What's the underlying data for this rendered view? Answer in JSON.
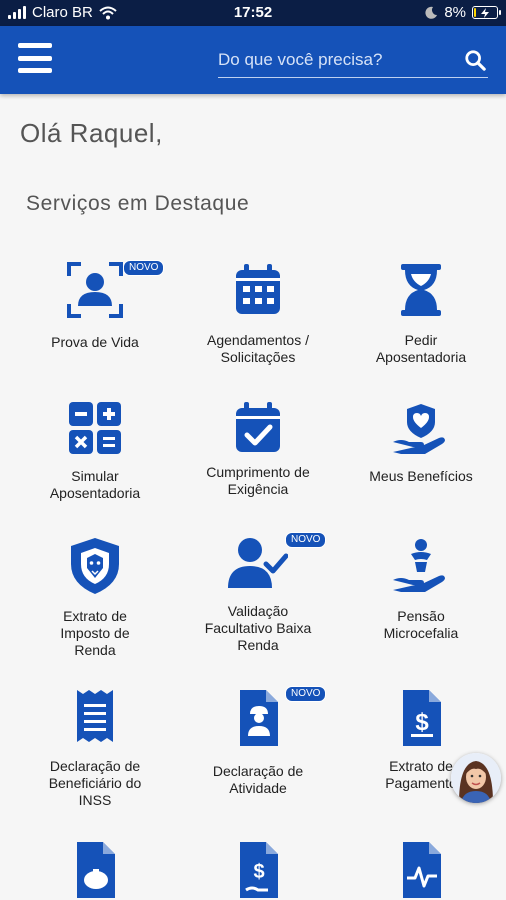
{
  "status_bar": {
    "carrier": "Claro BR",
    "time": "17:52",
    "battery": "8%",
    "battery_level": 0.08
  },
  "header": {
    "search_placeholder": "Do que você precisa?",
    "color": "#1552b8"
  },
  "greeting": "Olá Raquel,",
  "section_title": "Serviços em Destaque",
  "services": [
    {
      "label": "Prova de Vida",
      "icon": "face-scan-icon",
      "badge": "NOVO"
    },
    {
      "label": "Agendamentos /\nSolicitações",
      "icon": "calendar-icon",
      "badge": ""
    },
    {
      "label": "Pedir\nAposentadoria",
      "icon": "hourglass-icon",
      "badge": ""
    },
    {
      "label": "Simular\nAposentadoria",
      "icon": "calculator-icon",
      "badge": ""
    },
    {
      "label": "Cumprimento de\nExigência",
      "icon": "calendar-check-icon",
      "badge": ""
    },
    {
      "label": "Meus Benefícios",
      "icon": "hand-heart-icon",
      "badge": ""
    },
    {
      "label": "Extrato de\nImposto de\nRenda",
      "icon": "lion-shield-icon",
      "badge": ""
    },
    {
      "label": "Validação\nFacultativo Baixa\nRenda",
      "icon": "user-check-icon",
      "badge": "NOVO"
    },
    {
      "label": "Pensão\nMicrocefalia",
      "icon": "hand-baby-icon",
      "badge": ""
    },
    {
      "label": "Declaração de\nBeneficiário do\nINSS",
      "icon": "receipt-icon",
      "badge": ""
    },
    {
      "label": "Declaração de\nAtividade",
      "icon": "worker-document-icon",
      "badge": "NOVO"
    },
    {
      "label": "Extrato de\nPagamento",
      "icon": "dollar-document-icon",
      "badge": ""
    },
    {
      "label": "",
      "icon": "piggy-document-icon",
      "badge": ""
    },
    {
      "label": "",
      "icon": "money-hand-document-icon",
      "badge": ""
    },
    {
      "label": "",
      "icon": "pulse-document-icon",
      "badge": ""
    }
  ],
  "assistant": {
    "icon": "assistant-avatar-icon"
  }
}
